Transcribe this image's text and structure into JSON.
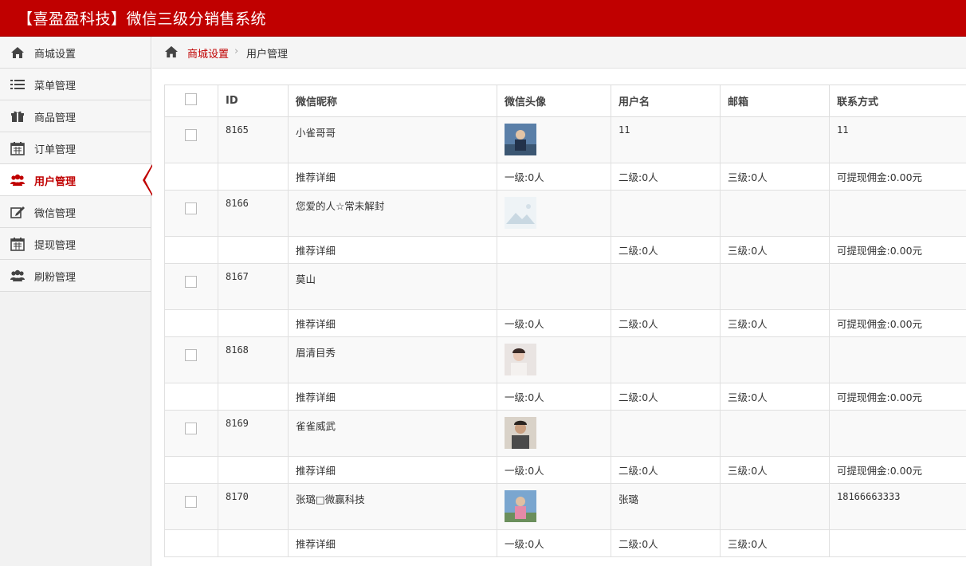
{
  "app": {
    "title": "【喜盈盈科技】微信三级分销售系统"
  },
  "sidebar": {
    "items": [
      {
        "label": "商城设置",
        "icon": "home-icon"
      },
      {
        "label": "菜单管理",
        "icon": "list-icon"
      },
      {
        "label": "商品管理",
        "icon": "gift-icon"
      },
      {
        "label": "订单管理",
        "icon": "calendar-icon"
      },
      {
        "label": "用户管理",
        "icon": "users-icon",
        "active": true
      },
      {
        "label": "微信管理",
        "icon": "edit-icon"
      },
      {
        "label": "提现管理",
        "icon": "calendar-icon"
      },
      {
        "label": "刷粉管理",
        "icon": "users-icon"
      }
    ]
  },
  "breadcrumb": {
    "parent": "商城设置",
    "separator": "›",
    "current": "用户管理"
  },
  "table": {
    "headers": [
      "ID",
      "微信昵称",
      "微信头像",
      "用户名",
      "邮箱",
      "联系方式"
    ],
    "rows": [
      {
        "id": "8165",
        "nickname": "小雀哥哥",
        "username": "11",
        "email": "",
        "contact": "11",
        "detail": "推荐详细",
        "level1": "一级:0人",
        "level2": "二级:0人",
        "level3": "三级:0人",
        "commission": "可提现佣金:0.00元"
      },
      {
        "id": "8166",
        "nickname": "您爱的人☆常未解封",
        "username": "",
        "email": "",
        "contact": "",
        "detail": "推荐详细",
        "level1": "",
        "level2": "二级:0人",
        "level3": "三级:0人",
        "commission": "可提现佣金:0.00元"
      },
      {
        "id": "8167",
        "nickname": "莫山",
        "username": "",
        "email": "",
        "contact": "",
        "detail": "推荐详细",
        "level1": "一级:0人",
        "level2": "二级:0人",
        "level3": "三级:0人",
        "commission": "可提现佣金:0.00元"
      },
      {
        "id": "8168",
        "nickname": "眉清目秀",
        "username": "",
        "email": "",
        "contact": "",
        "detail": "推荐详细",
        "level1": "一级:0人",
        "level2": "二级:0人",
        "level3": "三级:0人",
        "commission": "可提现佣金:0.00元"
      },
      {
        "id": "8169",
        "nickname": "雀雀威武",
        "username": "",
        "email": "",
        "contact": "",
        "detail": "推荐详细",
        "level1": "一级:0人",
        "level2": "二级:0人",
        "level3": "三级:0人",
        "commission": "可提现佣金:0.00元"
      },
      {
        "id": "8170",
        "nickname": "张璐□微赢科技",
        "username": "张璐",
        "email": "",
        "contact": "18166663333",
        "detail": "推荐详细",
        "level1": "一级:0人",
        "level2": "二级:0人",
        "level3": "三级:0人",
        "commission": ""
      }
    ]
  },
  "colors": {
    "brand": "#c00000",
    "sidebar_bg": "#f2f2f2"
  }
}
